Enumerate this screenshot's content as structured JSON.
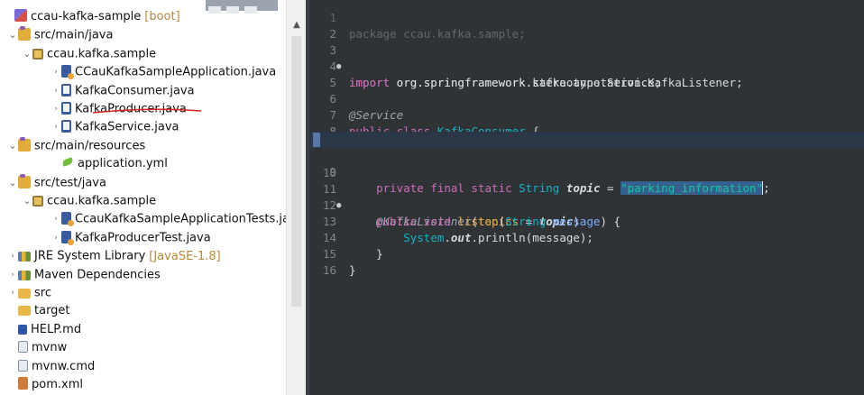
{
  "explorer": {
    "rows": [
      {
        "label": "ccau-kafka-sample",
        "decoration": "[boot]",
        "icon": "project-icon",
        "arrow": "",
        "indent": 4
      },
      {
        "label": "src/main/java",
        "decoration": "",
        "icon": "source-folder-icon",
        "arrow": "down",
        "indent": 8
      },
      {
        "label": "ccau.kafka.sample",
        "decoration": "",
        "icon": "package-icon",
        "arrow": "down",
        "indent": 24
      },
      {
        "label": "CCauKafkaSampleApplication.java",
        "decoration": "",
        "icon": "java-app-file-icon",
        "arrow": "right",
        "indent": 56
      },
      {
        "label": "KafkaConsumer.java",
        "decoration": "",
        "icon": "java-file-icon",
        "arrow": "right",
        "indent": 56
      },
      {
        "label": "KafkaProducer.java",
        "decoration": "",
        "icon": "java-file-icon",
        "arrow": "right",
        "indent": 56
      },
      {
        "label": "KafkaService.java",
        "decoration": "",
        "icon": "java-file-icon",
        "arrow": "right",
        "indent": 56
      },
      {
        "label": "src/main/resources",
        "decoration": "",
        "icon": "source-folder-icon",
        "arrow": "down",
        "indent": 8
      },
      {
        "label": "application.yml",
        "decoration": "",
        "icon": "spring-yml-icon",
        "arrow": "",
        "indent": 56
      },
      {
        "label": "src/test/java",
        "decoration": "",
        "icon": "source-folder-icon",
        "arrow": "down",
        "indent": 8
      },
      {
        "label": "ccau.kafka.sample",
        "decoration": "",
        "icon": "package-icon",
        "arrow": "down",
        "indent": 24
      },
      {
        "label": "CcauKafkaSampleApplicationTests.ja",
        "decoration": "",
        "icon": "java-app-file-icon",
        "arrow": "right",
        "indent": 56
      },
      {
        "label": "KafkaProducerTest.java",
        "decoration": "",
        "icon": "java-app-file-icon",
        "arrow": "right",
        "indent": 56
      },
      {
        "label": "JRE System Library",
        "decoration": "[JavaSE-1.8]",
        "icon": "library-icon",
        "arrow": "right",
        "indent": 8
      },
      {
        "label": "Maven Dependencies",
        "decoration": "",
        "icon": "library-icon",
        "arrow": "right",
        "indent": 8
      },
      {
        "label": "src",
        "decoration": "",
        "icon": "folder-icon",
        "arrow": "right",
        "indent": 8
      },
      {
        "label": "target",
        "decoration": "",
        "icon": "folder-icon",
        "arrow": "",
        "indent": 8
      },
      {
        "label": "HELP.md",
        "decoration": "",
        "icon": "markdown-file-icon",
        "arrow": "",
        "indent": 8
      },
      {
        "label": "mvnw",
        "decoration": "",
        "icon": "file-icon",
        "arrow": "",
        "indent": 8
      },
      {
        "label": "mvnw.cmd",
        "decoration": "",
        "icon": "file-icon",
        "arrow": "",
        "indent": 8
      },
      {
        "label": "pom.xml",
        "decoration": "",
        "icon": "xml-file-icon",
        "arrow": "",
        "indent": 8
      }
    ]
  },
  "editor": {
    "line_numbers": [
      "1",
      "2",
      "3",
      "4",
      "5",
      "6",
      "7",
      "8",
      "9",
      "10",
      "11",
      "12",
      "13",
      "14",
      "15",
      "16"
    ],
    "line1": {
      "kw": "package",
      "rest": " ccau.kafka.sample;"
    },
    "line3": {
      "kw": "import",
      "rest": " org.springframework.kafka.annotation.KafkaListener;"
    },
    "line4": {
      "kw": "import",
      "rest": " org.springframework.stereotype.Service;"
    },
    "line6": {
      "ann": "@Service"
    },
    "line7": {
      "kw": "public class",
      "cls": "KafkaConsumer",
      "rest": " {"
    },
    "line9": {
      "kw": "private final static",
      "type": "String",
      "field": "topic",
      "eq": " = ",
      "str": "\"parking_information\"",
      "end": ";"
    },
    "line11": {
      "ann": "@KafkaListener",
      "open": "(",
      "method": "topics",
      "eq": " = ",
      "field": "topic",
      "close": ")"
    },
    "line12": {
      "kw": "public void",
      "method": "listen",
      "open": "(",
      "type": "String",
      "param": "message",
      "close": ") {"
    },
    "line13": {
      "cls": "System",
      "dot": ".",
      "field": "out",
      "rest": ".println(message);"
    },
    "line14": {
      "rest": "}"
    },
    "line15": {
      "rest": "}"
    }
  },
  "colors": {
    "editor_bg": "#2f3336",
    "keyword": "#cc6cb8",
    "string": "#17c6a3",
    "type": "#19b0c4",
    "method": "#e8a640",
    "red_underline": "#d9261c"
  }
}
